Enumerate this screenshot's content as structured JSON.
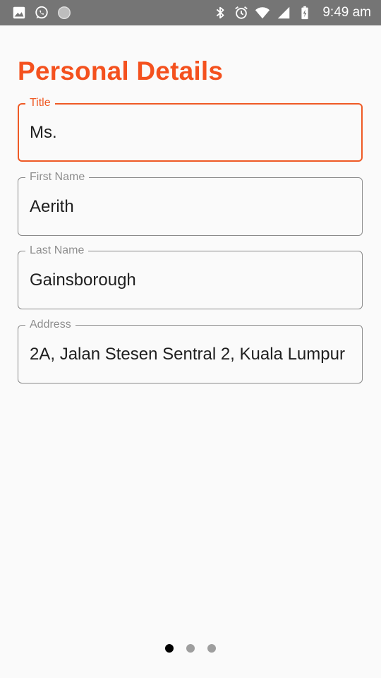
{
  "status_bar": {
    "time": "9:49 am",
    "left_icons": [
      "image-icon",
      "whatsapp-icon",
      "circle-icon"
    ],
    "right_icons": [
      "bluetooth-icon",
      "alarm-icon",
      "wifi-icon",
      "signal-icon",
      "battery-charging-icon"
    ]
  },
  "page": {
    "title": "Personal Details",
    "accent_color": "#f4511e"
  },
  "form": {
    "title_field": {
      "label": "Title",
      "value": "Ms."
    },
    "first_name_field": {
      "label": "First Name",
      "value": "Aerith"
    },
    "last_name_field": {
      "label": "Last Name",
      "value": "Gainsborough"
    },
    "address_field": {
      "label": "Address",
      "value": "2A, Jalan Stesen Sentral 2, Kuala Lumpur"
    }
  },
  "pager": {
    "total": 3,
    "current": 1
  }
}
